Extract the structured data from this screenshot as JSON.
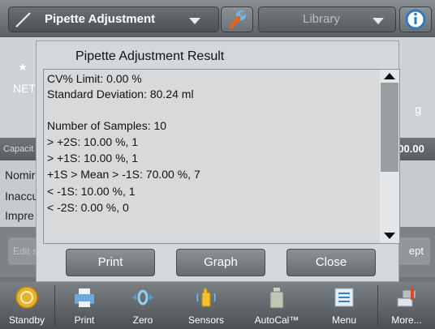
{
  "header": {
    "app_name": "Pipette Adjustment",
    "library_label": "Library",
    "wrench_icon": "wrench-icon",
    "info_icon": "info-icon"
  },
  "background": {
    "star": "*",
    "net_label": "NET",
    "unit": "g",
    "capacity_label": "Capacit",
    "capacity_value": ":00.00",
    "rows": [
      "Nomir",
      "Inaccu",
      "Impre"
    ],
    "edit_button": "Edit s",
    "accept_button": "ept"
  },
  "dialog": {
    "title": "Pipette Adjustment Result",
    "lines": [
      "CV% Limit: 0.00 %",
      "Standard Deviation: 80.24 ml",
      "",
      "Number of Samples: 10",
      "> +2S: 10.00 %, 1",
      "> +1S: 10.00 %, 1",
      "+1S > Mean > -1S: 70.00 %, 7",
      "< -1S: 10.00 %, 1",
      "< -2S: 0.00 %, 0"
    ],
    "buttons": {
      "print": "Print",
      "graph": "Graph",
      "close": "Close"
    }
  },
  "toolbar": {
    "items": [
      {
        "label": "Standby",
        "icon": "standby-icon"
      },
      {
        "label": "Print",
        "icon": "printer-icon"
      },
      {
        "label": "Zero",
        "icon": "zero-icon"
      },
      {
        "label": "Sensors",
        "icon": "hand-sensor-icon"
      },
      {
        "label": "AutoCal™",
        "icon": "calibration-weight-icon"
      },
      {
        "label": "Menu",
        "icon": "menu-icon"
      },
      {
        "label": "More...",
        "icon": "more-icon"
      }
    ]
  }
}
